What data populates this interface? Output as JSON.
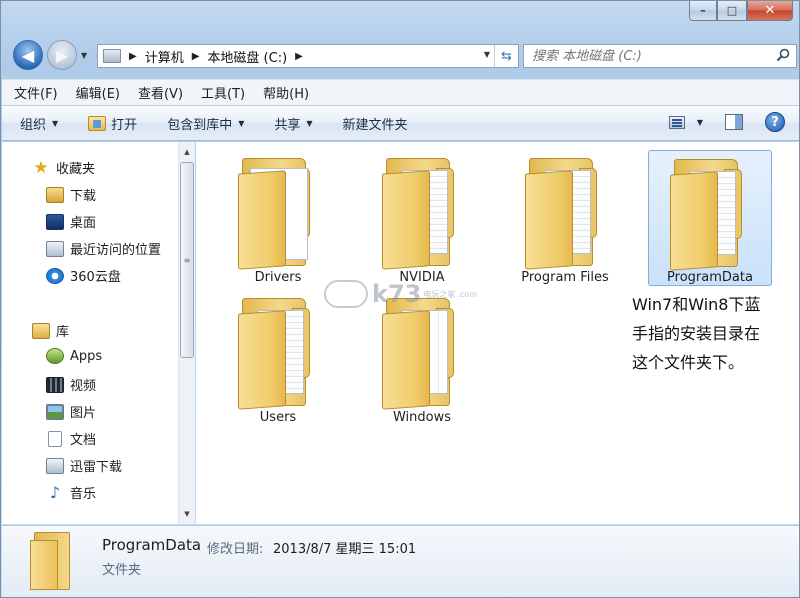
{
  "window": {
    "caption_buttons": [
      "–",
      "□",
      "✕"
    ]
  },
  "address": {
    "segments": [
      "计算机",
      "本地磁盘 (C:)"
    ]
  },
  "search": {
    "placeholder": "搜索 本地磁盘 (C:)"
  },
  "menubar": {
    "items": [
      "文件(F)",
      "编辑(E)",
      "查看(V)",
      "工具(T)",
      "帮助(H)"
    ]
  },
  "toolbar": {
    "organize": "组织",
    "open": "打开",
    "include_in_library": "包含到库中",
    "share": "共享",
    "new_folder": "新建文件夹"
  },
  "navpane": {
    "favorites": {
      "label": "收藏夹",
      "items": [
        "下载",
        "桌面",
        "最近访问的位置",
        "360云盘"
      ]
    },
    "libraries": {
      "label": "库",
      "items": [
        "Apps",
        "视频",
        "图片",
        "文档",
        "迅雷下载",
        "音乐"
      ]
    }
  },
  "folders": [
    {
      "name": "Drivers",
      "selected": false
    },
    {
      "name": "NVIDIA",
      "selected": false
    },
    {
      "name": "Program Files",
      "selected": false
    },
    {
      "name": "ProgramData",
      "selected": true
    },
    {
      "name": "Users",
      "selected": false
    },
    {
      "name": "Windows",
      "selected": false
    }
  ],
  "watermark": {
    "text": "k73",
    "sub": "电玩之家",
    "sub2": ".com"
  },
  "annotation": {
    "lines": [
      "Win7和Win8下蓝",
      "手指的安装目录在",
      "这个文件夹下。"
    ]
  },
  "details": {
    "name": "ProgramData",
    "modified_label": "修改日期:",
    "modified_value": "2013/8/7 星期三 15:01",
    "type": "文件夹"
  },
  "colors": {
    "selection_border": "#84acdd",
    "selection_fill": "#cce3fa",
    "folder_yellow": "#f0cc6a"
  }
}
